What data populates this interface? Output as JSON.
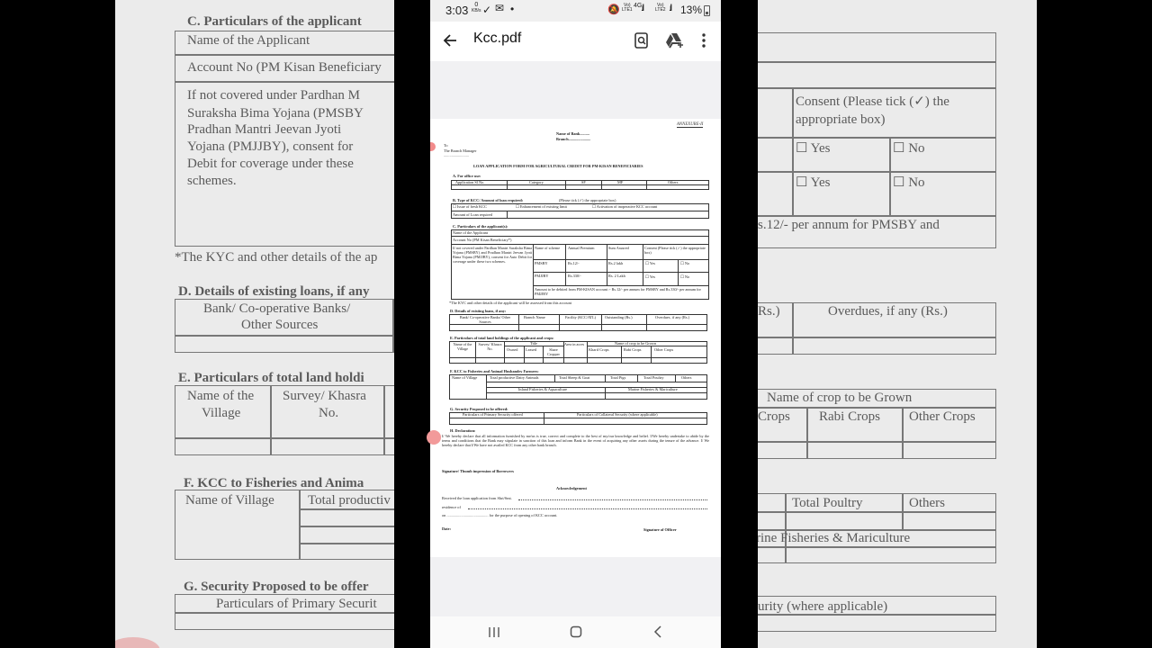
{
  "status_bar": {
    "time": "3:03",
    "data_speed_value": "0",
    "data_speed_unit": "KB/s",
    "net1_top": "Vo)",
    "net1_bottom": "LTE1",
    "net_type": "4G",
    "net2_top": "Vo)",
    "net2_bottom": "LTE2",
    "battery": "13%"
  },
  "app_bar": {
    "title": "Kcc.pdf"
  },
  "pdf": {
    "annexure": "ANNEXURE-II",
    "name_of_bank": "Name of Bank..........",
    "branch": "Branch.......................",
    "to": "To",
    "branch_manager": "The Branch Manager",
    "dots": "..........................",
    "form_title": "LOAN APPLICATION FORM FOR AGRICULTURAL CREDIT FOR PM-KISAN BENEFICIARIES",
    "sec_a": "A.   For office use:",
    "sec_a_cols": [
      "Application Sl No.",
      "Category",
      "SF",
      "MF",
      "Others"
    ],
    "sec_b": "B.   Type of KCC/ Amount of loan required:",
    "sec_b_note": "(Please tick (✓) the appropriate box)",
    "sec_b_opts": [
      "☐ Issue of fresh KCC",
      "☐ Enhancement of existing limit",
      "☐ Activation of inoperative KCC account"
    ],
    "sec_b_amount": "Amount of Loan required",
    "sec_c": "C.   Particulars of the applicant(s):",
    "sec_c_name": "Name of the Applicant",
    "sec_c_account": "Account No (PM Kisan Beneficiary*)",
    "sec_c_para": "If not covered under Pardhan Mantri Suraksha Bima Yojana (PMSBY) and Pradhan Mantri Jeevan Jyoti Bima Yojana (PMJJBY), consent for Auto Debit for coverage under these two schemes.",
    "sec_c_head": [
      "Name of scheme",
      "Annual Premium",
      "Sum Assured",
      "Consent (Please tick (✓) the appropriate box)"
    ],
    "sec_c_rows": [
      [
        "PMSBY",
        "Rs.12/-",
        "Rs.2 lakh",
        "☐ Yes",
        "☐ No"
      ],
      [
        "PMJJBY",
        "Rs.330/-",
        "Rs. 2 Lakh",
        "☐ Yes",
        "☐ No"
      ]
    ],
    "sec_c_debit": "Amount to be debited from PM-KISAN account :- Rs.12/- per annum for PMSBY and Rs.330/- per annum for PMJJBY",
    "kyc_note": "*The KYC and other details of the applicant will be assessed from this account",
    "sec_d": "D.   Details of existing loans, if any:",
    "sec_d_cols": [
      "Bank/ Co-operative Banks/ Other Sources",
      "Branch Name",
      "Facility (KCC/ATL)",
      "Outstanding (Rs.)",
      "Overdues, if any (Rs.)"
    ],
    "sec_e": "E.   Particulars of total land holdings of the applicant and crops:",
    "sec_e_cols": [
      "Name of the Village",
      "Survey/ Khasra No.",
      "Title",
      "Area in acres",
      "Name of crop to be Grown"
    ],
    "sec_e_title_sub": [
      "Owned",
      "Leased",
      "Share Cropper"
    ],
    "sec_e_crop_sub": [
      "Kharif Crops",
      "Rabi Crops",
      "Other Crops"
    ],
    "sec_f": "F.   KCC to Fisheries and Animal Husbandry Farmers:",
    "sec_f_cols": [
      "Name of Village",
      "Total productive Dairy Animals",
      "Total Sheep & Goat",
      "Total Pigs",
      "Total Poultry",
      "Others"
    ],
    "sec_f_sub": [
      "Inland Fisheries & Aquaculture",
      "Marine Fisheries & Mariculture"
    ],
    "sec_g": "G.   Security Proposed to be offered:",
    "sec_g_cols": [
      "Particulars of Primary Security offered",
      "Particulars of Collateral Security (where applicable)"
    ],
    "sec_h": "H.   Declaration:",
    "sec_h_text": "I/ We hereby declare that all information furnished by me/us is true, correct and complete to the best of my/our knowledge and belief. I/We hereby undertake to abide by the terms and conditions that the Bank may stipulate in sanction of this loan and inform Bank in the event of acquiring any other assets during the tenure of the advance. I/ We hereby declare that I/We have not availed KCC from any other bank branch.",
    "signature": "Signature/ Thumb impression of Borrowers",
    "ack": "Acknowledgement",
    "ack_line1": "Received the loan application from Shri/Smt.",
    "ack_line2": "residence of",
    "ack_line3": "on ........................................... for the purpose of opening of KCC account.",
    "date": "Date:",
    "officer": "Signature of Officer"
  },
  "background_left": {
    "sec_c": "C.   Particulars of the applicant",
    "name": "Name of the Applicant",
    "account": "Account No (PM Kisan Beneficiary",
    "para_lines": [
      "If  not  covered  under  Pardhan  M",
      "Suraksha  Bima  Yojana  (PMSBY",
      "Pradhan  Mantri  Jeevan  Jyoti",
      "Yojana  (PMJJBY),  consent  for",
      "Debit  for  coverage  under  these",
      "schemes."
    ],
    "kyc": "*The KYC and other details of the ap",
    "sec_d": "D.   Details of existing loans, if any",
    "bank_col": [
      "Bank/ Co-operative Banks/",
      "Other Sources"
    ],
    "sec_e": "E.   Particulars of total land holdi",
    "village": [
      "Name of the",
      "Village"
    ],
    "survey": [
      "Survey/ Khasra",
      "No."
    ],
    "sec_f": "F.   KCC to Fisheries and Anima",
    "village2": "Name of Village",
    "productive": "Total productiv",
    "sec_g": "G.   Security Proposed to be offer",
    "primary": "Particulars of Primary Securit"
  },
  "background_right": {
    "consent": [
      "Consent (Please tick (✓) the",
      "appropriate box)"
    ],
    "yes": "☐ Yes",
    "no": "☐ No",
    "per_annum": "s.12/- per annum for PMSBY and",
    "rs": "Rs.)",
    "overdues": "Overdues, if any (Rs.)",
    "crop_head": "Name of crop to be Grown",
    "crops": "Crops",
    "rabi": "Rabi Crops",
    "other": "Other Crops",
    "poultry": "Total Poultry",
    "others": "Others",
    "marine": "rine Fisheries & Mariculture",
    "collateral": "urity (where applicable)"
  }
}
